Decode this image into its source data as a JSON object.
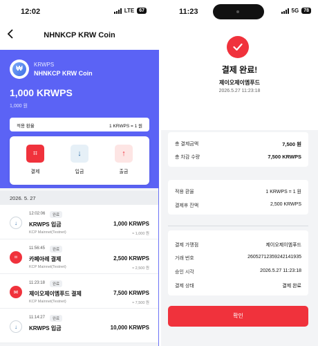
{
  "left": {
    "status": {
      "time": "12:02",
      "network": "LTE",
      "battery": "67"
    },
    "nav": {
      "back_icon": "chevron-left-icon",
      "title": "NHNKCP KRW Coin"
    },
    "coin": {
      "symbol": "KRWPS",
      "name": "NHNKCP KRW Coin",
      "balance": "1,000 KRWPS",
      "balance_krw": "1,000 원",
      "rate_label": "적용 환율",
      "rate_value": "1 KRWPS = 1 원"
    },
    "actions": [
      {
        "label": "결제",
        "icon": "qr-scan-icon",
        "glyph": "⌗"
      },
      {
        "label": "입금",
        "icon": "arrow-down-icon",
        "glyph": "↓"
      },
      {
        "label": "출금",
        "icon": "arrow-up-icon",
        "glyph": "↑"
      }
    ],
    "date_header": "2026. 5. 27",
    "transactions": [
      {
        "time": "12:02:06",
        "badge": "완료",
        "name": "KRWPS 입금",
        "network": "KCP Mainnet(Testnet)",
        "amount": "1,000 KRWPS",
        "krw": "≈ 1,000 원",
        "type": "deposit",
        "glyph": "↓"
      },
      {
        "time": "11:56:45",
        "badge": "완료",
        "name": "카페아레 결제",
        "network": "KCP Mainnet(Testnet)",
        "amount": "2,500 KRWPS",
        "krw": "≈ 2,500 원",
        "type": "payment",
        "glyph": "⌗"
      },
      {
        "time": "11:23:18",
        "badge": "완료",
        "name": "제이오제이엠푸드 결제",
        "network": "KCP Mainnet(Testnet)",
        "amount": "7,500 KRWPS",
        "krw": "≈ 7,500 원",
        "type": "payment",
        "glyph": "✉"
      },
      {
        "time": "11:14:27",
        "badge": "완료",
        "name": "KRWPS 입금",
        "network": "",
        "amount": "10,000 KRWPS",
        "krw": "",
        "type": "deposit",
        "glyph": "↓"
      }
    ]
  },
  "right": {
    "status": {
      "time": "11:23",
      "network": "5G",
      "battery": "78"
    },
    "result": {
      "check_icon": "check-circle-icon",
      "title": "결제 완료!",
      "merchant": "제이오제이엠푸드",
      "datetime": "2026.5.27 11:23:18"
    },
    "summary": [
      {
        "label": "총 결제금액",
        "value": "7,500 원"
      },
      {
        "label": "총 차감 수량",
        "value": "7,500 KRWPS",
        "accent": true
      }
    ],
    "rate": [
      {
        "label": "적용 환율",
        "value": "1 KRWPS = 1 원"
      },
      {
        "label": "결제후 잔액",
        "value": "2,500 KRWPS"
      }
    ],
    "details": [
      {
        "label": "결제 가맹점",
        "value": "제이오제이엠푸드"
      },
      {
        "label": "거래 번호",
        "value": "26052712359242141935"
      },
      {
        "label": "승인 시각",
        "value": "2026.5.27 11:23:18"
      },
      {
        "label": "결제 상태",
        "value": "결제 완료"
      }
    ],
    "confirm_label": "확인"
  },
  "colors": {
    "brand_blue": "#5b63f5",
    "accent_red": "#f0323c"
  }
}
